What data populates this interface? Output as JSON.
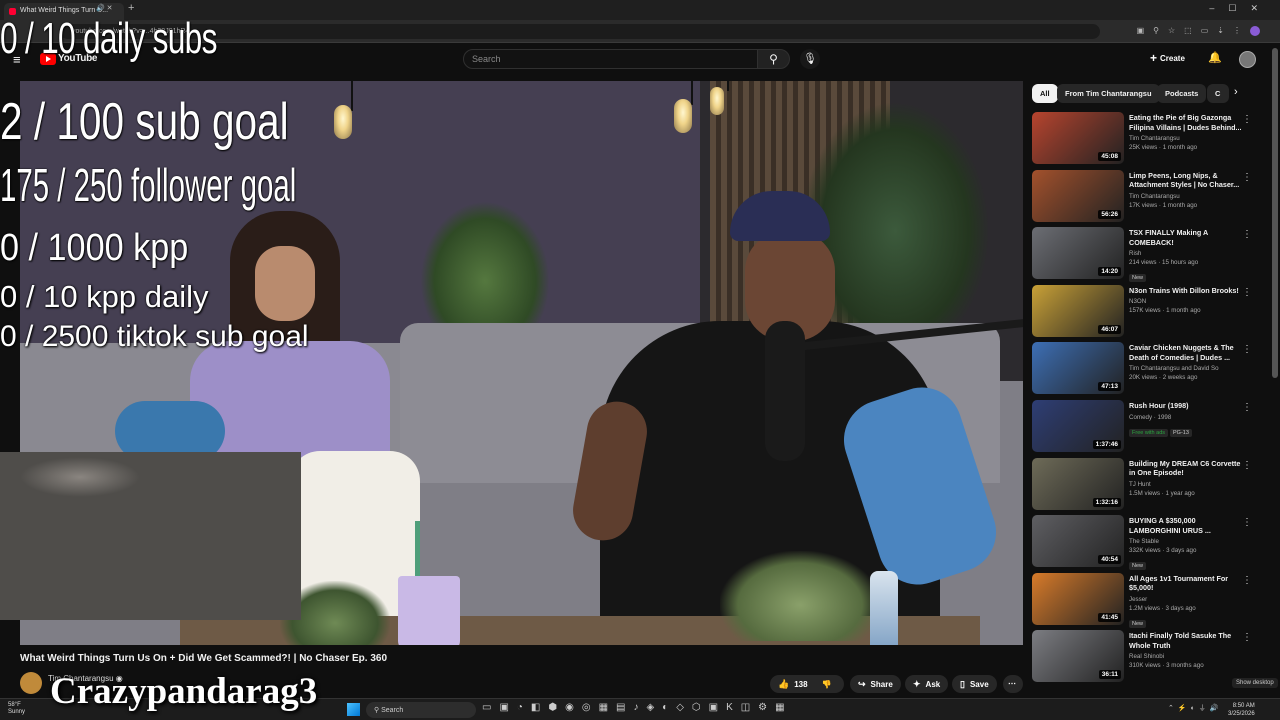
{
  "browser": {
    "tab_title": "What Weird Things Turn U...",
    "url": "youtube.com/watch?v=...4h28J91hR4"
  },
  "youtube": {
    "logo_text": "YouTube",
    "search_placeholder": "Search",
    "create_label": "Create"
  },
  "overlay": {
    "daily_subs": "0 / 10 daily subs",
    "sub_goal": "2  / 100 sub goal",
    "follower_goal": "175 / 250 follower goal",
    "kpp": "0 / 1000 kpp",
    "kpp_daily": "0 / 10 kpp daily",
    "tiktok_goal": "0 / 2500 tiktok sub goal",
    "streamer_name": "Crazypandarag3"
  },
  "video": {
    "title": "What Weird Things Turn Us On + Did We Get Scammed?! | No Chaser Ep. 360",
    "channel": "Tim Chantarangsu",
    "like_count": "138",
    "share_label": "Share",
    "ask_label": "Ask",
    "save_label": "Save"
  },
  "chips": [
    "All",
    "From Tim Chantarangsu",
    "Podcasts",
    "C"
  ],
  "recommendations": [
    {
      "title": "Eating the Pie of Big Gazonga Filipina Villains | Dudes Behind...",
      "channel": "Tim Chantarangsu",
      "meta": "25K views · 1 month ago",
      "duration": "45:08",
      "badges": [],
      "color": "#b7442e"
    },
    {
      "title": "Limp Peens, Long Nips, & Attachment Styles | No Chaser...",
      "channel": "Tim Chantarangsu",
      "meta": "17K views · 1 month ago",
      "duration": "56:26",
      "badges": [],
      "color": "#a3512c"
    },
    {
      "title": "TSX FINALLY Making A COMEBACK!",
      "channel": "Rish",
      "meta": "214 views · 15 hours ago",
      "duration": "14:20",
      "badges": [
        "New"
      ],
      "color": "#6c6e74"
    },
    {
      "title": "N3on Trains With Dillon Brooks!",
      "channel": "N3ON",
      "meta": "157K views · 1 month ago",
      "duration": "46:07",
      "badges": [],
      "color": "#c9a137"
    },
    {
      "title": "Caviar Chicken Nuggets & The Death of Comedies | Dudes ...",
      "channel": "Tim Chantarangsu and David So",
      "meta": "20K views · 2 weeks ago",
      "duration": "47:13",
      "badges": [],
      "color": "#3d6fb5"
    },
    {
      "title": "Rush Hour (1998)",
      "channel": "Comedy · 1998",
      "meta": "",
      "duration": "1:37:46",
      "badges": [
        "Free with ads",
        "PG-13"
      ],
      "color": "#2e3e75"
    },
    {
      "title": "Building My DREAM C6 Corvette in One Episode!",
      "channel": "TJ Hunt",
      "meta": "1.5M views · 1 year ago",
      "duration": "1:32:16",
      "badges": [],
      "color": "#6e6b58"
    },
    {
      "title": "BUYING A $350,000 LAMBORGHINI URUS ...",
      "channel": "The Stable",
      "meta": "332K views · 3 days ago",
      "duration": "40:54",
      "badges": [
        "New"
      ],
      "color": "#5f5f63"
    },
    {
      "title": "All Ages 1v1 Tournament For $5,000!",
      "channel": "Jesser",
      "meta": "1.2M views · 3 days ago",
      "duration": "41:45",
      "badges": [
        "New"
      ],
      "color": "#d87b2a"
    },
    {
      "title": "Itachi Finally Told Sasuke The Whole Truth",
      "channel": "Real Shinobi",
      "meta": "310K views · 3 months ago",
      "duration": "36:11",
      "badges": [],
      "color": "#7c7d82"
    }
  ],
  "system": {
    "show_desktop": "Show desktop",
    "weather_temp": "58°F",
    "weather_cond": "Sunny",
    "taskbar_search": "Search",
    "time": "8:50 AM",
    "date": "3/25/2026"
  }
}
